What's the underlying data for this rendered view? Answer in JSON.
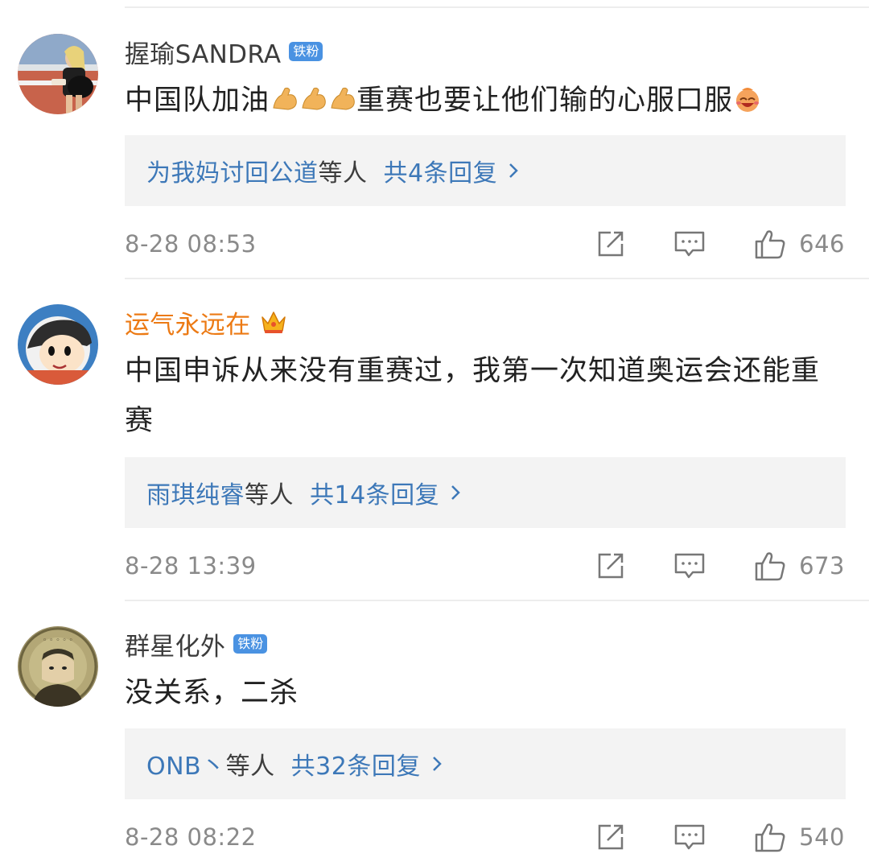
{
  "comments": [
    {
      "username": "握瑜SANDRA",
      "badge": "铁粉",
      "text_before": "中国队加油",
      "emoji_before": [
        "strong-arm-emoji",
        "strong-arm-emoji",
        "strong-arm-emoji"
      ],
      "text_after": "重赛也要让他们输的心服口服",
      "emoji_after": [
        "laughing-face-emoji"
      ],
      "reply_users": "为我妈讨回公道",
      "reply_etc": "等人",
      "reply_count": "共4条回复",
      "time": "8-28 08:53",
      "likes": "646"
    },
    {
      "username": "运气永远在",
      "badge_icon": "crown-icon",
      "text_before": "中国申诉从来没有重赛过，我第一次知道奥运会还能重赛",
      "reply_users": "雨琪纯睿",
      "reply_etc": "等人",
      "reply_count": "共14条回复",
      "time": "8-28 13:39",
      "likes": "673"
    },
    {
      "username": "群星化外",
      "badge": "铁粉",
      "text_before": "没关系，二杀",
      "reply_users": "ONB丶",
      "reply_etc": "等人",
      "reply_count": "共32条回复",
      "time": "8-28 08:22",
      "likes": "540"
    }
  ],
  "colors": {
    "link_blue": "#3d78b8",
    "vip_orange": "#ec7a14",
    "badge_blue": "#4a92e2",
    "meta_gray": "#8a8a8a",
    "reply_bg": "#f3f3f3"
  }
}
